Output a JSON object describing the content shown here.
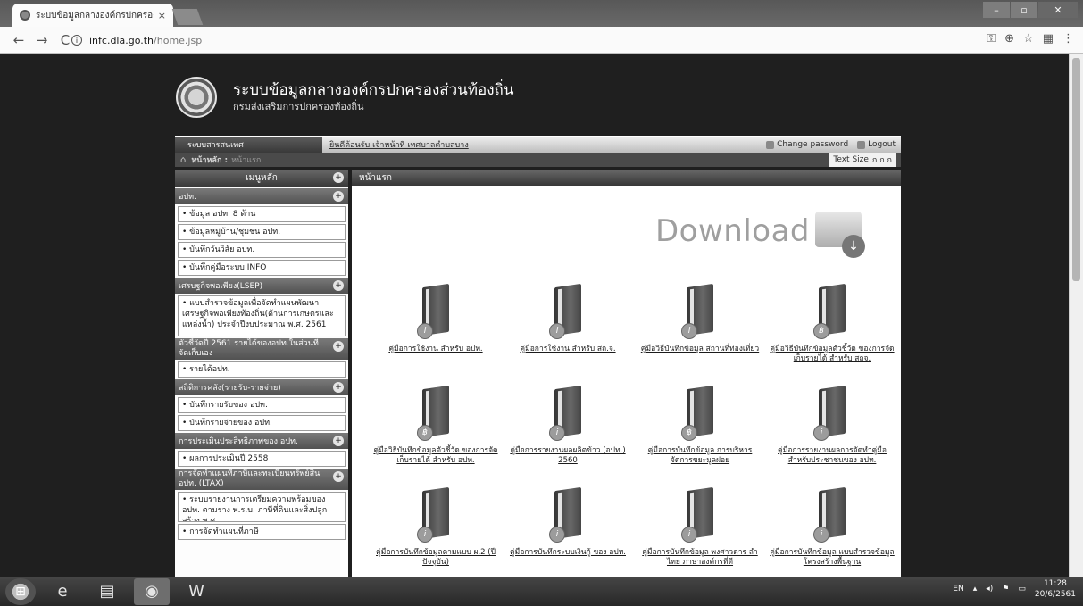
{
  "browser": {
    "tab_title": "ระบบข้อมูลกลางองค์กรปกครองส่วนท้องถิ่น",
    "tab_close": "×",
    "url_domain": "infc.dla.go.th",
    "url_path": "/home.jsp",
    "nav": {
      "back": "←",
      "forward": "→",
      "reload": "C"
    },
    "window_controls": {
      "minimize": "–",
      "maximize": "▫",
      "close": "✕"
    },
    "toolbar_icons": [
      "key-icon",
      "zoom-icon",
      "star-icon",
      "menu-icon"
    ]
  },
  "site": {
    "title": "ระบบข้อมูลกลางองค์กรปกครองส่วนท้องถิ่น",
    "subtitle": "กรมส่งเสริมการปกครองท้องถิ่น"
  },
  "topbar": {
    "system_label": "ระบบสารสนเทศ",
    "welcome": "ยินดีต้อนรับ เจ้าหน้าที่ เทศบาลตำบลบาง",
    "change_password": "Change password",
    "logout": "Logout"
  },
  "breadcrumb": {
    "label": "หน้าหลัก :",
    "value": "หน้าแรก",
    "text_size_label": "Text Size",
    "text_size_options": "ก ก ก"
  },
  "sidebar": {
    "menu_title": "เมนูหลัก",
    "sections": [
      {
        "title": "อปท.",
        "items": [
          "ข้อมูล อปท. 8 ด้าน",
          "ข้อมูลหมู่บ้าน/ชุมชน อปท.",
          "บันทึกวันวิสัย อปท.",
          "บันทึกคู่มือระบบ INFO"
        ]
      },
      {
        "title": "เศรษฐกิจพอเพียง(LSEP)",
        "items": [
          "แบบสำรวจข้อมูลเพื่อจัดทำแผนพัฒนาเศรษฐกิจพอเพียงท้องถิ่น(ด้านการเกษตรและแหล่งน้ำ) ประจำปีงบประมาณ พ.ศ. 2561"
        ]
      },
      {
        "title": "ตัวชี้วัดปี 2561 รายได้ของอปท.ในส่วนที่จัดเก็บเอง",
        "items": [
          "รายได้อปท."
        ]
      },
      {
        "title": "สถิติการคลัง(รายรับ-รายจ่าย)",
        "items": [
          "บันทึกรายรับของ อปท.",
          "บันทึกรายจ่ายของ อปท."
        ]
      },
      {
        "title": "การประเมินประสิทธิภาพของ อปท.",
        "items": [
          "ผลการประเมินปี 2558"
        ]
      },
      {
        "title": "การจัดทำแผนที่ภาษีและทะเบียนทรัพย์สิน อปท. (LTAX)",
        "items": [
          "ระบบรายงานการเตรียมความพร้อมของ อปท. ตามร่าง พ.ร.บ. ภาษีที่ดินและสิ่งปลูกสร้าง พ.ศ. ...",
          "การจัดทำแผนที่ภาษี"
        ]
      }
    ]
  },
  "main": {
    "header": "หน้าแรก",
    "download_text": "Download",
    "docs": [
      {
        "title": "คู่มือการใช้งาน สำหรับ อปท.",
        "badge": "i"
      },
      {
        "title": "คู่มือการใช้งาน สำหรับ สถ.จ.",
        "badge": "i"
      },
      {
        "title": "คู่มือวิธีบันทึกข้อมูล สถานที่ท่องเที่ยว",
        "badge": "i"
      },
      {
        "title": "คู่มือวิธีบันทึกข้อมูลตัวชี้วัด ของการจัดเก็บรายได้ สำหรับ สถจ.",
        "badge": "฿"
      },
      {
        "title": "คู่มือวิธีบันทึกข้อมูลตัวชี้วัด ของการจัดเก็บรายได้ สำหรับ อปท.",
        "badge": "฿"
      },
      {
        "title": "คู่มือการรายงานผลผลิตข้าว (อปท.) 2560",
        "badge": "i"
      },
      {
        "title": "คู่มือการบันทึกข้อมูล การบริหารจัดการขยะมูลฝอย",
        "badge": "฿"
      },
      {
        "title": "คู่มือการรายงานผลการจัดทำคู่มือ สำหรับประชาชนของ อปท.",
        "badge": "i"
      },
      {
        "title": "คู่มือการบันทึกข้อมูลตามแบบ ผ.2 (ปีปัจจุบัน)",
        "badge": "i"
      },
      {
        "title": "คู่มือการบันทึกระบบเงินกู้ ของ อปท.",
        "badge": "i"
      },
      {
        "title": "คู่มือการบันทึกข้อมูล พงศาวดาร ลำไทย ภาษาองค์กรที่ดี",
        "badge": "i"
      },
      {
        "title": "คู่มือการบันทึกข้อมูล แบบสำรวจข้อมูลโครงสร้างพื้นฐาน",
        "badge": "i"
      }
    ]
  },
  "taskbar": {
    "apps": [
      "ie-icon",
      "explorer-icon",
      "chrome-icon",
      "word-icon"
    ],
    "lang": "EN",
    "time": "11:28",
    "date": "20/6/2561"
  }
}
